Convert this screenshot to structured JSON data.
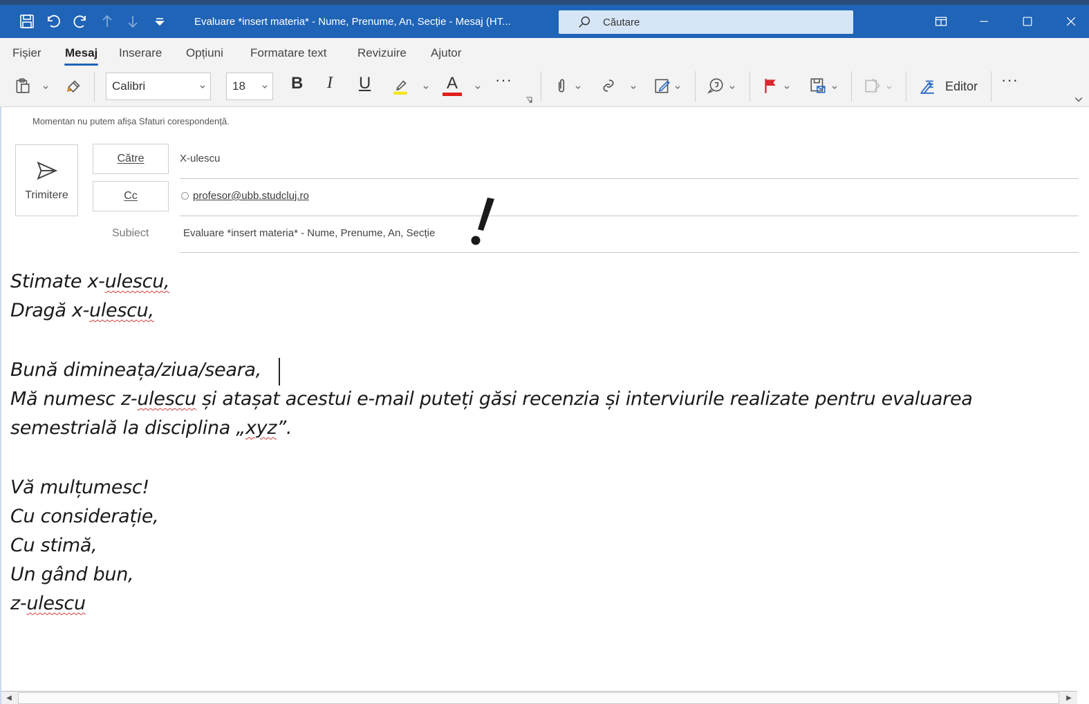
{
  "window": {
    "title": "Evaluare *insert materia* - Nume, Prenume, An, Secție  -  Mesaj (HT...",
    "search_placeholder": "Căutare"
  },
  "menu": {
    "tabs": [
      "Fișier",
      "Mesaj",
      "Inserare",
      "Opțiuni",
      "Formatare text",
      "Revizuire",
      "Ajutor"
    ],
    "active": "Mesaj"
  },
  "ribbon": {
    "font_name": "Calibri",
    "font_size": "18",
    "bold_label": "B",
    "italic_label": "I",
    "underline_label": "U",
    "font_color_label": "A",
    "more_label": "···",
    "editor_label": "Editor",
    "overflow_label": "···",
    "highlight_color": "#f5e51c",
    "font_color": "#e0201b"
  },
  "notice": "Momentan nu putem afișa Sfaturi corespondență.",
  "compose": {
    "send_label": "Trimitere",
    "to_label": "Către",
    "to_value": "X-ulescu",
    "cc_label": "Cc",
    "cc_value": "profesor@ubb.studcluj.ro",
    "subject_label": "Subiect",
    "subject_value": "Evaluare *insert materia* - Nume, Prenume, An, Secție"
  },
  "body": {
    "greeting_1_pre": "Stimate x-",
    "greeting_1_sq": "ulescu,",
    "greeting_2_pre": "Dragă x-",
    "greeting_2_sq": "ulescu,",
    "salutation": "Bună dimineața/ziua/seara,",
    "line_1_pre": "Mă numesc z-",
    "line_1_sq": "ulescu",
    "line_1_post": " și atașat acestui e-mail puteți găsi recenzia și interviurile realizate pentru evaluarea",
    "line_2_pre": "semestrială la disciplina „",
    "line_2_sq": "xyz",
    "line_2_post": "”.",
    "closing_1": "Vă mulțumesc!",
    "closing_2": "Cu considerație,",
    "closing_3": "Cu stimă,",
    "closing_4": "Un gând bun,",
    "signature_pre": "z-",
    "signature_sq": "ulescu"
  }
}
